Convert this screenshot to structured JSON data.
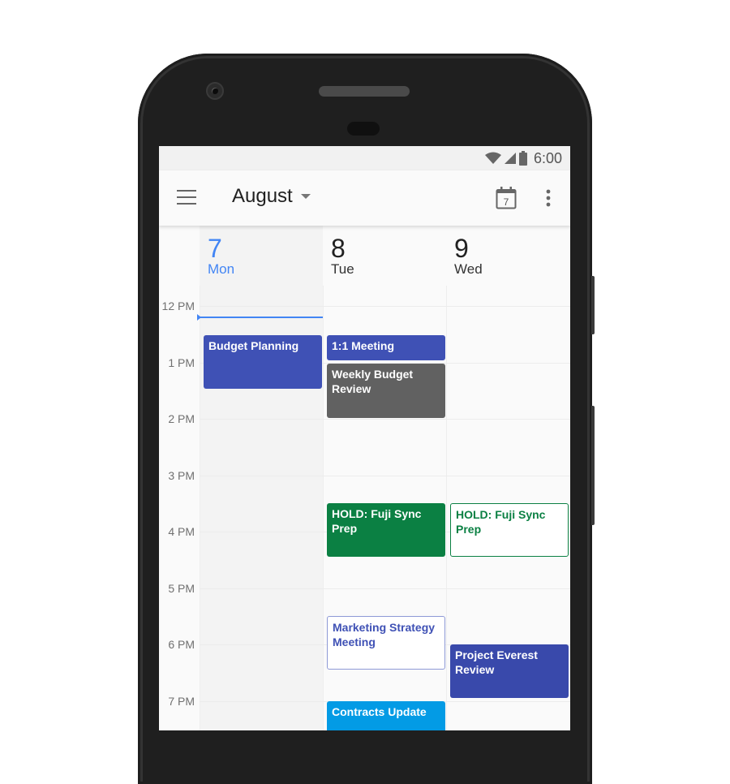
{
  "status_bar": {
    "time": "6:00",
    "icons": [
      "wifi-icon",
      "cell-signal-icon",
      "battery-icon"
    ]
  },
  "app_bar": {
    "menu_icon": "hamburger-menu-icon",
    "title": "August",
    "title_dropdown_icon": "caret-down-icon",
    "today_button_day": "7",
    "today_icon": "calendar-today-icon",
    "more_icon": "more-vert-icon"
  },
  "days": [
    {
      "number": "7",
      "name": "Mon",
      "is_today": true
    },
    {
      "number": "8",
      "name": "Tue",
      "is_today": false
    },
    {
      "number": "9",
      "name": "Wed",
      "is_today": false
    }
  ],
  "hours": [
    "12 PM",
    "1 PM",
    "2 PM",
    "3 PM",
    "4 PM",
    "5 PM",
    "6 PM",
    "7 PM"
  ],
  "events": [
    {
      "title": "Budget Planning",
      "day": 0,
      "start": 12.52,
      "end": 13.47,
      "style": "blue",
      "color": "#3f51b5"
    },
    {
      "title": "1:1 Meeting",
      "day": 1,
      "start": 12.52,
      "end": 12.97,
      "style": "blue",
      "color": "#3f51b5"
    },
    {
      "title": "Weekly Budget Review",
      "day": 1,
      "start": 13.02,
      "end": 13.98,
      "style": "gray",
      "color": "#616161"
    },
    {
      "title": "HOLD: Fuji Sync Prep",
      "day": 1,
      "start": 15.5,
      "end": 16.45,
      "style": "green",
      "color": "#0b8043"
    },
    {
      "title": "HOLD: Fuji Sync Prep",
      "day": 2,
      "start": 15.5,
      "end": 16.45,
      "style": "green-outline",
      "color": "#0b8043"
    },
    {
      "title": "Marketing Strategy Meeting",
      "day": 1,
      "start": 17.5,
      "end": 18.45,
      "style": "blue-outline",
      "color": "#3f51b5"
    },
    {
      "title": "Project Everest Review",
      "day": 2,
      "start": 18.0,
      "end": 18.95,
      "style": "darkblue",
      "color": "#3949ab"
    },
    {
      "title": "Contracts Update",
      "day": 1,
      "start": 19.0,
      "end": 20.0,
      "style": "lightblue",
      "color": "#039be5"
    }
  ],
  "current_time_hour": 12.18,
  "colors": {
    "accent": "#4285f4",
    "today_column": "#f3f3f3"
  }
}
